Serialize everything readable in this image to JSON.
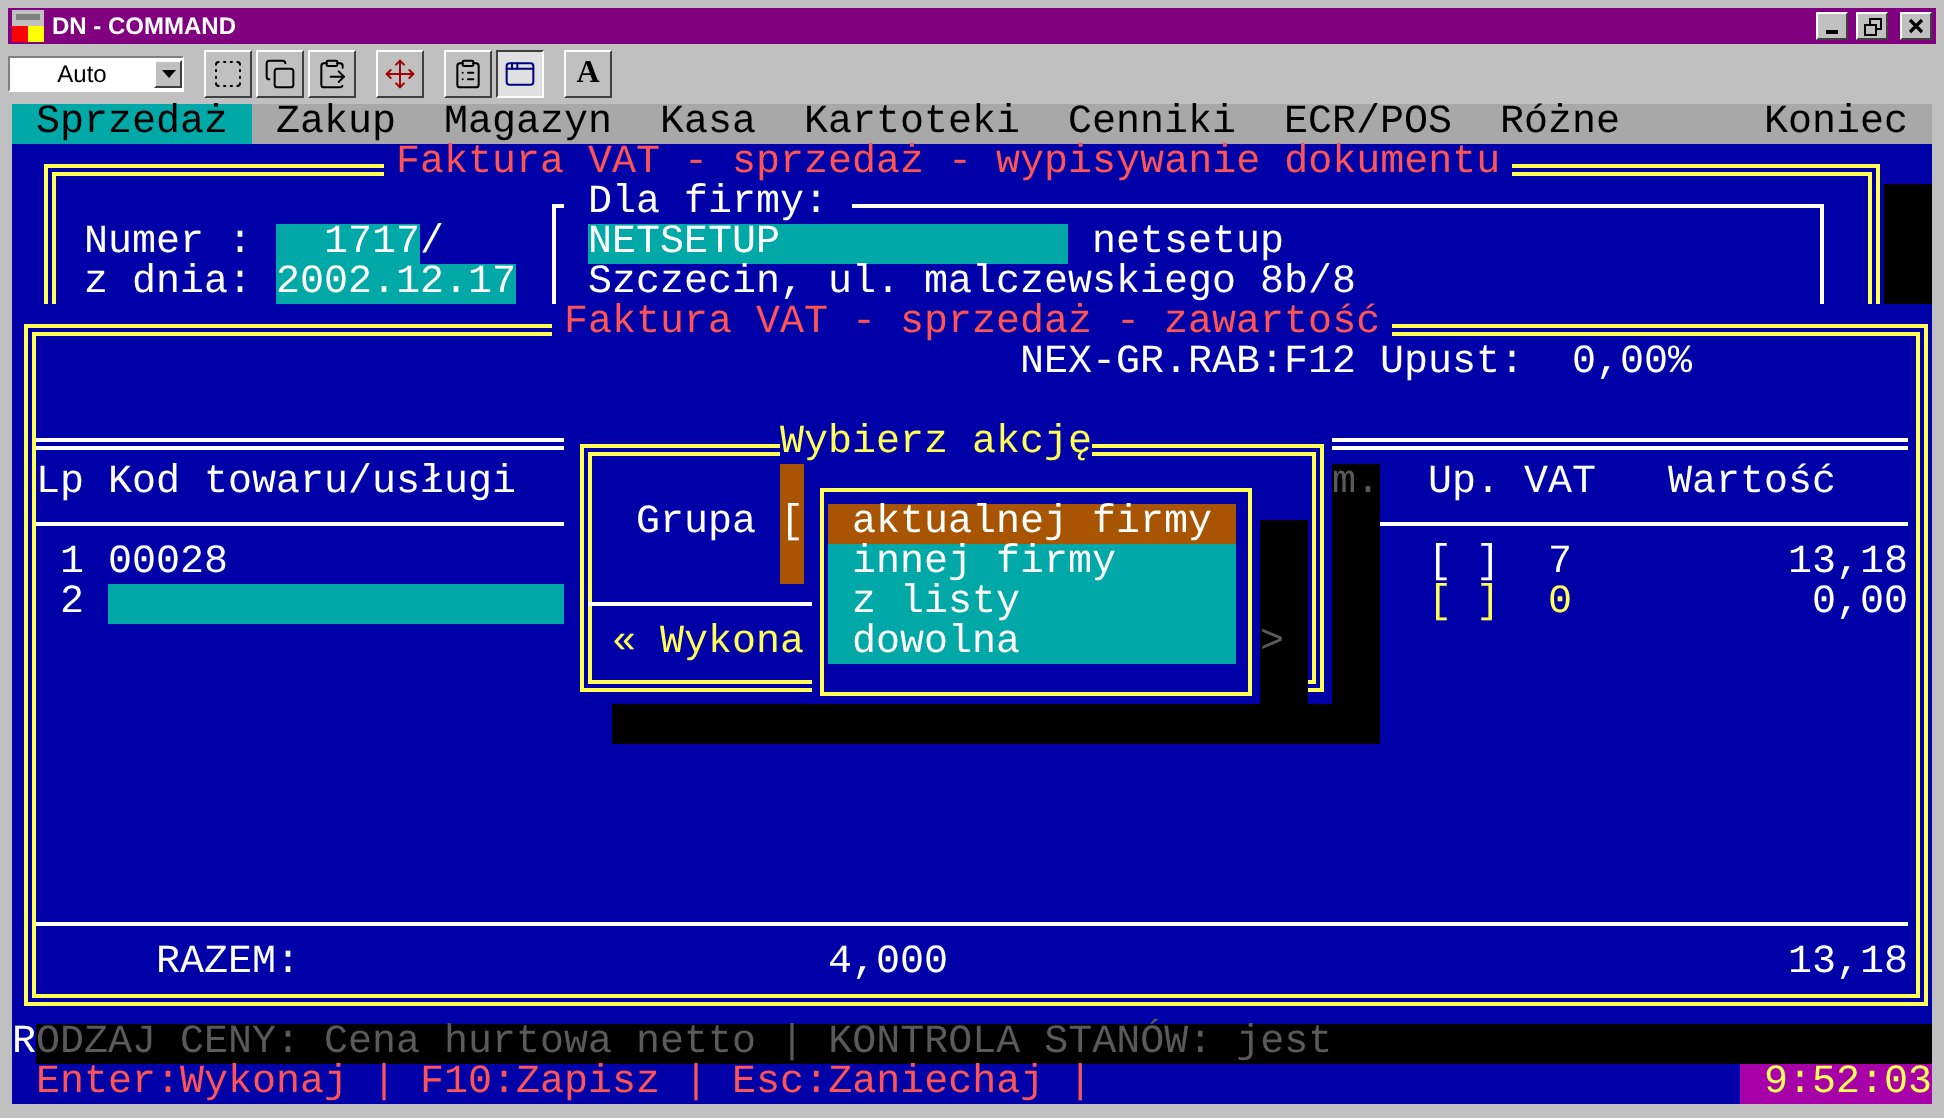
{
  "window": {
    "title": "DN - COMMAND"
  },
  "toolbar": {
    "font_mode": "Auto",
    "font_button": "A"
  },
  "menu": [
    {
      "label": "Sprzedaż",
      "selected": true
    },
    {
      "label": "Zakup",
      "selected": false
    },
    {
      "label": "Magazyn",
      "selected": false
    },
    {
      "label": "Kasa",
      "selected": false
    },
    {
      "label": "Kartoteki",
      "selected": false
    },
    {
      "label": "Cenniki",
      "selected": false
    },
    {
      "label": "ECR/POS",
      "selected": false
    },
    {
      "label": "Różne",
      "selected": false
    },
    {
      "label": "Koniec",
      "selected": false
    }
  ],
  "invoice_header": {
    "title": "Faktura VAT - sprzedaż - wypisywanie dokumentu",
    "number_label": "Numer :",
    "number": "1717",
    "number_suffix": "/",
    "date_label": "z dnia:",
    "date": "2002.12.17",
    "client_label": "Dla firmy:",
    "client_code": "NETSETUP",
    "client_name": "netsetup",
    "client_address": "Szczecin, ul. malczewskiego 8b/8"
  },
  "invoice_content": {
    "title": "Faktura VAT - sprzedaż - zawartość",
    "discount": "NEX-GR.RAB:F12 Upust:  0,00%",
    "columns": [
      {
        "label": "Lp",
        "shaded": false
      },
      {
        "label": "Kod towaru/usługi",
        "shaded": false
      },
      {
        "label": "m.",
        "shaded": true
      },
      {
        "label": "Up.",
        "shaded": false
      },
      {
        "label": "VAT",
        "shaded": false
      },
      {
        "label": "Wartość",
        "shaded": false
      }
    ],
    "rows": [
      {
        "lp": "1",
        "code": "00028",
        "up": "[ ]",
        "vat": "7",
        "value": "13,18",
        "selected": false
      },
      {
        "lp": "2",
        "up": "[ ]",
        "vat": "0",
        "value": "0,00",
        "selected": true
      }
    ],
    "total_label": "RAZEM:",
    "total_quantity": "4,000",
    "total_value": "13,18"
  },
  "action_dialog": {
    "title": "Wybierz akcję",
    "group_label": "Grupa",
    "group_field": "[",
    "execute_button": "« Wykona",
    "shaded_arrow": ">"
  },
  "action_menu": [
    {
      "label": "aktualnej firmy",
      "selected": true
    },
    {
      "label": "innej firmy",
      "selected": false
    },
    {
      "label": "z listy",
      "selected": false
    },
    {
      "label": "dowolna",
      "selected": false
    }
  ],
  "status_line": {
    "cursor_char": "R",
    "text": "ODZAJ CENY: Cena hurtowa netto | KONTROLA STANÓW: jest"
  },
  "key_hints": "Enter:Wykonaj | F10:Zapisz | Esc:Zaniechaj |",
  "clock": "9:52:03"
}
